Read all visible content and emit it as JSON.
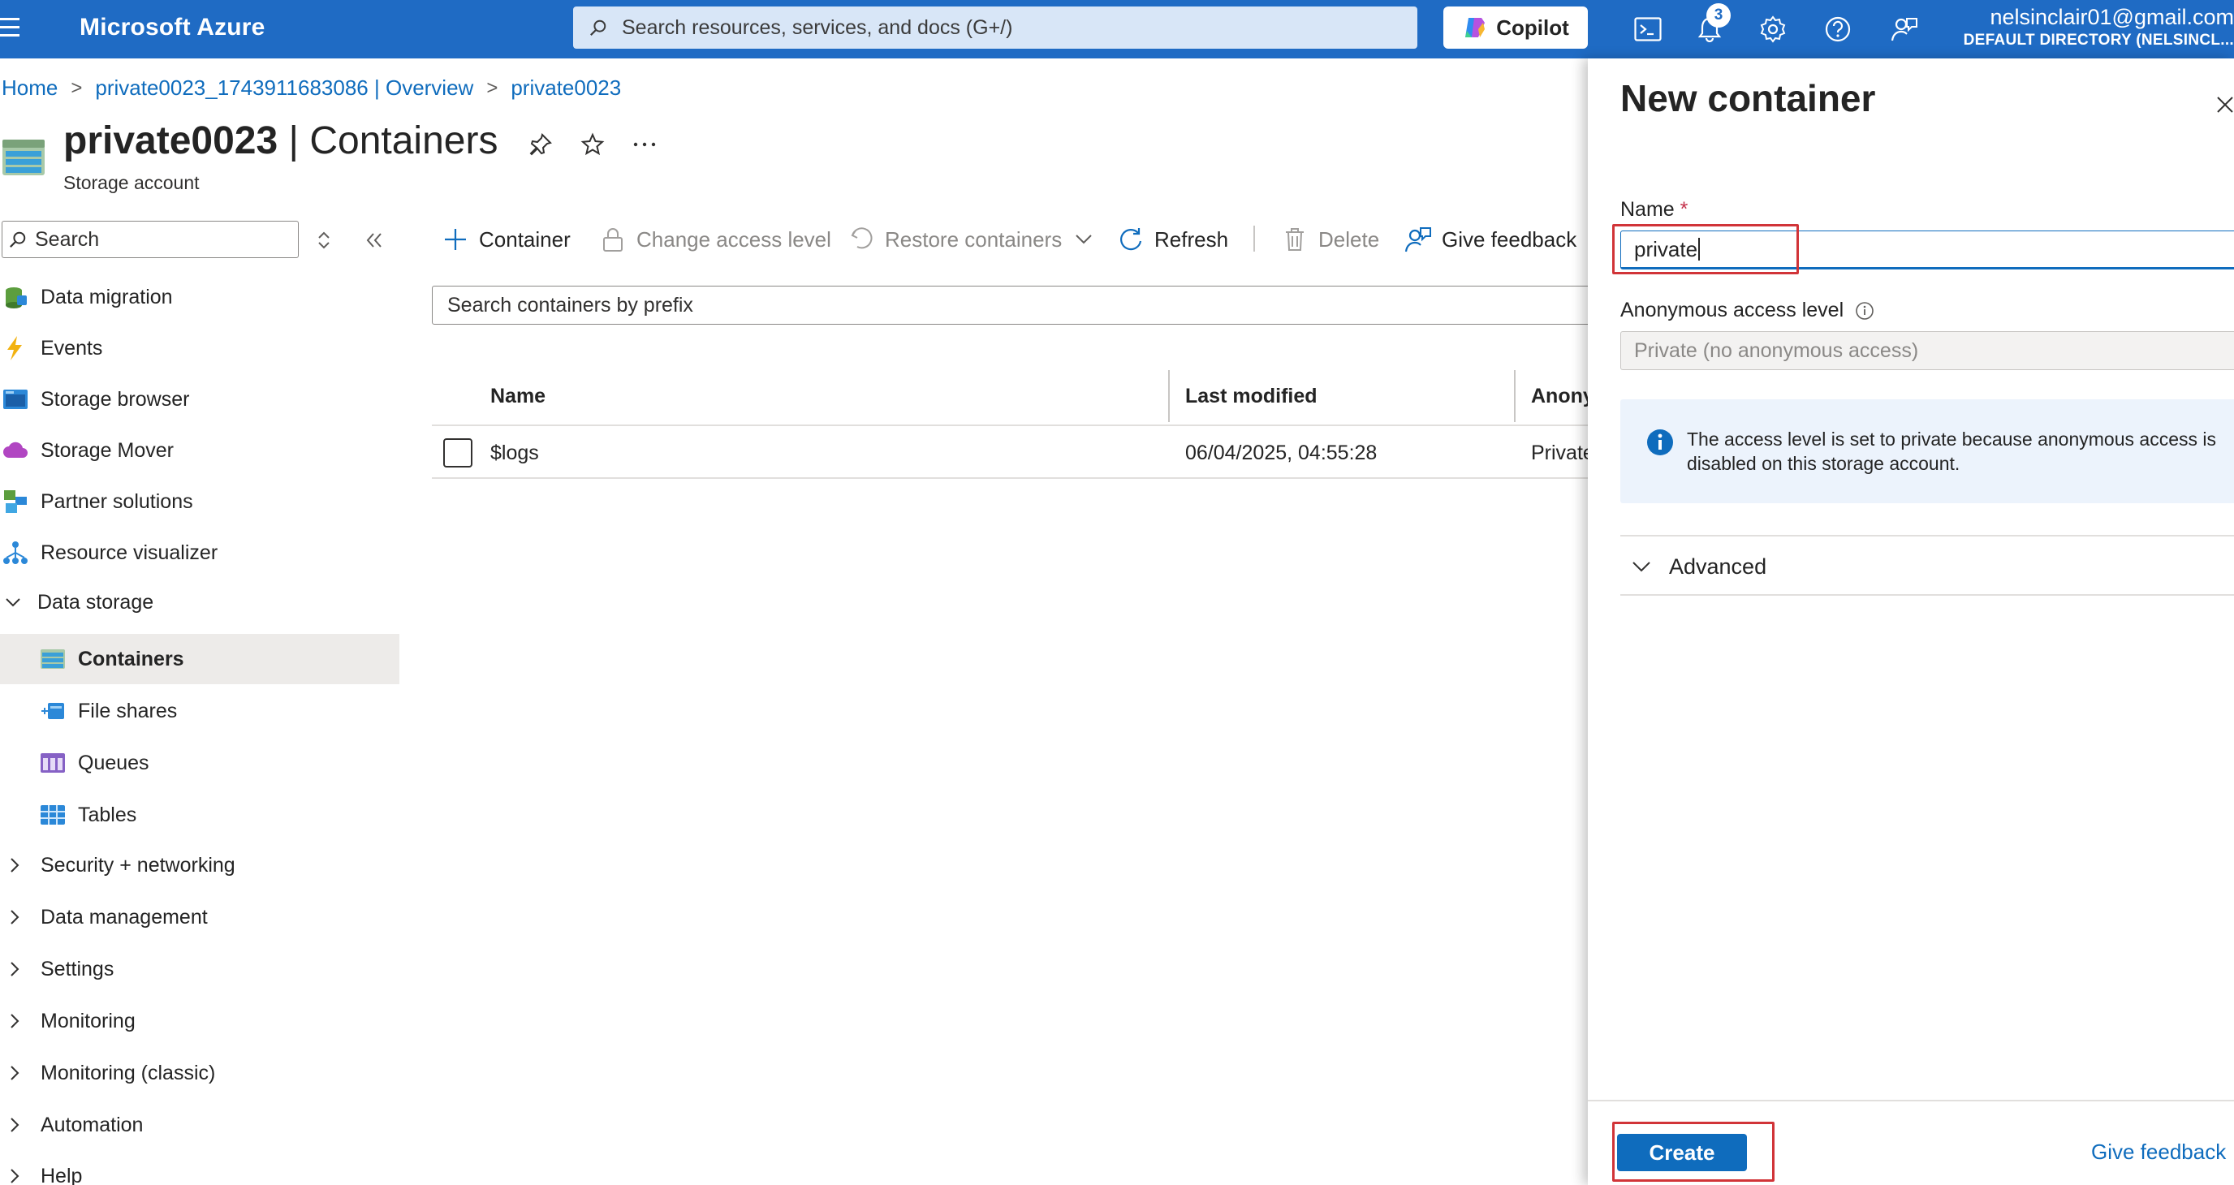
{
  "topbar": {
    "brand": "Microsoft Azure",
    "search_placeholder": "Search resources, services, and docs (G+/)",
    "copilot_label": "Copilot",
    "notification_count": "3",
    "user_email": "nelsinclair01@gmail.com",
    "user_directory": "DEFAULT DIRECTORY (NELSINCL..."
  },
  "breadcrumb": [
    "Home",
    "private0023_1743911683086 | Overview",
    "private0023"
  ],
  "header": {
    "title_bold": "private0023",
    "title_rest": " | Containers",
    "subtitle": "Storage account"
  },
  "nav": {
    "search_label": "Search",
    "items": [
      {
        "label": "Data migration",
        "icon": "data-migration-icon"
      },
      {
        "label": "Events",
        "icon": "lightning-icon"
      },
      {
        "label": "Storage browser",
        "icon": "storage-browser-icon"
      },
      {
        "label": "Storage Mover",
        "icon": "cloud-icon"
      },
      {
        "label": "Partner solutions",
        "icon": "partner-icon"
      },
      {
        "label": "Resource visualizer",
        "icon": "hierarchy-icon"
      },
      {
        "label": "Data storage",
        "icon": "chevron-down-icon"
      },
      {
        "label": "Containers",
        "icon": "container-icon"
      },
      {
        "label": "File shares",
        "icon": "file-share-icon"
      },
      {
        "label": "Queues",
        "icon": "queue-icon"
      },
      {
        "label": "Tables",
        "icon": "table-icon"
      },
      {
        "label": "Security + networking",
        "icon": "chevron-right-icon"
      },
      {
        "label": "Data management",
        "icon": "chevron-right-icon"
      },
      {
        "label": "Settings",
        "icon": "chevron-right-icon"
      },
      {
        "label": "Monitoring",
        "icon": "chevron-right-icon"
      },
      {
        "label": "Monitoring (classic)",
        "icon": "chevron-right-icon"
      },
      {
        "label": "Automation",
        "icon": "chevron-right-icon"
      },
      {
        "label": "Help",
        "icon": "chevron-right-icon"
      }
    ]
  },
  "toolbar": {
    "container": "Container",
    "change_access": "Change access level",
    "restore": "Restore containers",
    "refresh": "Refresh",
    "delete": "Delete",
    "feedback": "Give feedback"
  },
  "main": {
    "prefix_placeholder": "Search containers by prefix",
    "columns": [
      "Name",
      "Last modified",
      "Anony"
    ],
    "rows": [
      {
        "name": "$logs",
        "modified": "06/04/2025, 04:55:28",
        "access": "Private"
      }
    ]
  },
  "panel": {
    "title": "New container",
    "name_label": "Name",
    "required_mark": "*",
    "name_value": "private",
    "access_label": "Anonymous access level",
    "access_value": "Private (no anonymous access)",
    "info_text": "The access level is set to private because anonymous access is disabled on this storage account.",
    "advanced": "Advanced",
    "create": "Create",
    "feedback": "Give feedback"
  },
  "colors": {
    "topbar": "#1f6bc4",
    "accent": "#0f6cbd",
    "highlight": "#d13438"
  }
}
